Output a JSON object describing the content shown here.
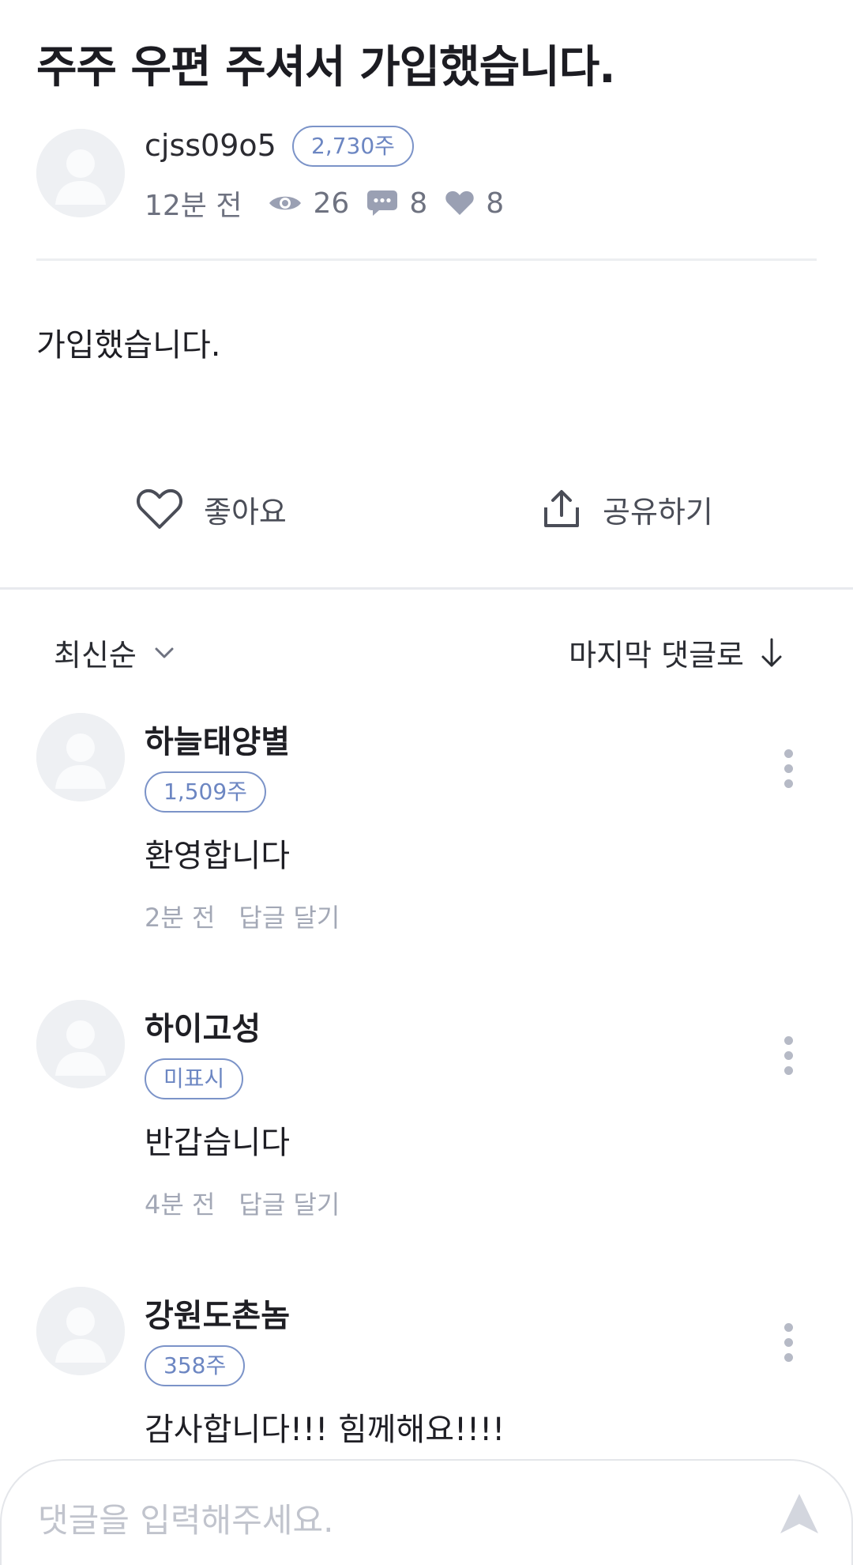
{
  "post": {
    "title": "주주 우편 주셔서 가입했습니다.",
    "author": "cjss09o5",
    "author_badge": "2,730주",
    "time": "12분 전",
    "views": "26",
    "comments": "8",
    "likes": "8",
    "body": "가입했습니다."
  },
  "actions": {
    "like_label": "좋아요",
    "share_label": "공유하기"
  },
  "sort": {
    "order_label": "최신순",
    "jump_label": "마지막 댓글로"
  },
  "comments": [
    {
      "name": "하늘태양별",
      "badge": "1,509주",
      "text": "환영합니다",
      "time": "2분 전",
      "reply": "답글 달기"
    },
    {
      "name": "하이고성",
      "badge": "미표시",
      "text": "반갑습니다",
      "time": "4분 전",
      "reply": "답글 달기"
    },
    {
      "name": "강원도촌놈",
      "badge": "358주",
      "text": "감사합니다!!! 힘께해요!!!!",
      "time": "",
      "reply": ""
    }
  ],
  "comment_input": {
    "placeholder": "댓글을 입력해주세요."
  },
  "icons": {
    "views": "eye-icon",
    "comments": "speech-bubble-icon",
    "likes": "heart-icon",
    "like_action": "heart-outline-icon",
    "share_action": "share-icon",
    "sort": "chevron-down-icon",
    "jump": "arrow-down-icon",
    "more": "kebab-menu-icon",
    "send": "send-icon"
  },
  "colors": {
    "accent": "#6c86c2",
    "text": "#1f1f24",
    "muted": "#a3a8b6"
  }
}
